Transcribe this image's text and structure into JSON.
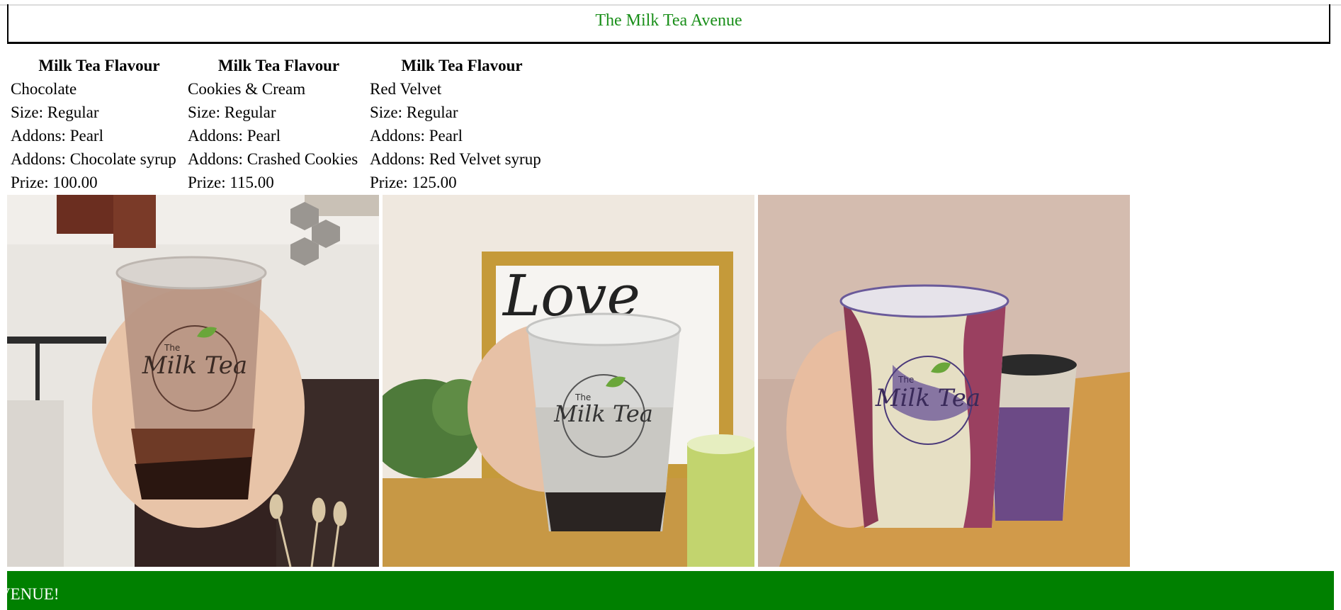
{
  "header": {
    "title": "The Milk Tea Avenue"
  },
  "menu": [
    {
      "heading": "Milk Tea Flavour",
      "name": "Chocolate",
      "size": "Size: Regular",
      "addon1": "Addons: Pearl",
      "addon2": "Addons: Chocolate syrup",
      "price": "Prize: 100.00"
    },
    {
      "heading": "Milk Tea Flavour",
      "name": "Cookies & Cream",
      "size": "Size: Regular",
      "addon1": "Addons: Pearl",
      "addon2": "Addons: Crashed Cookies",
      "price": "Prize: 115.00"
    },
    {
      "heading": "Milk Tea Flavour",
      "name": "Red Velvet",
      "size": "Size: Regular",
      "addon1": "Addons: Pearl",
      "addon2": "Addons: Red Velvet syrup",
      "price": "Prize: 125.00"
    }
  ],
  "photos": {
    "logo_word": "Milk Tea",
    "logo_small": "The"
  },
  "footer": {
    "marquee": "VENUE!"
  },
  "colors": {
    "brand_green": "#008000",
    "title_green": "#1a8f1a"
  }
}
